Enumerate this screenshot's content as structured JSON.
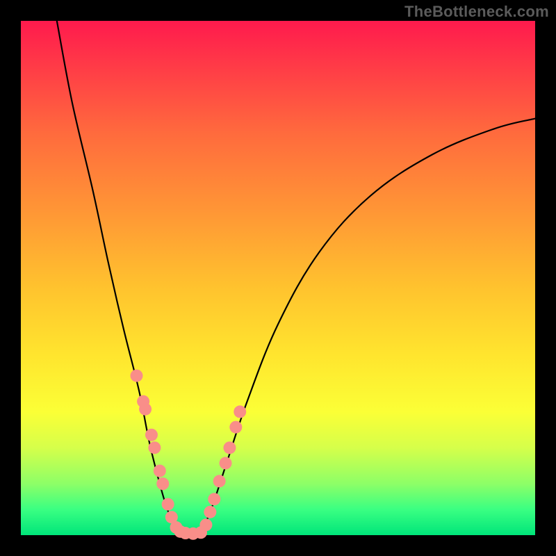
{
  "watermark": "TheBottleneck.com",
  "colors": {
    "frame": "#000000",
    "gradient_top": "#ff1a4d",
    "gradient_bottom": "#00e57a",
    "dot_fill": "#f98e89",
    "curve_stroke": "#000000"
  },
  "chart_data": {
    "type": "line",
    "title": "",
    "xlabel": "",
    "ylabel": "",
    "xlim": [
      0,
      100
    ],
    "ylim": [
      0,
      100
    ],
    "note": "Axes have no printed tick labels; values are normalized 0–100. Color gradient runs red (top, y≈100) → green (bottom, y≈0).",
    "series": [
      {
        "name": "left-branch",
        "x": [
          7,
          10,
          14,
          17,
          20,
          23,
          25,
          27,
          28.5,
          30,
          31
        ],
        "y": [
          100,
          84,
          67,
          53,
          40,
          28,
          18,
          10,
          5,
          1.5,
          0.5
        ]
      },
      {
        "name": "valley",
        "x": [
          31,
          33,
          35
        ],
        "y": [
          0.5,
          0.3,
          0.5
        ]
      },
      {
        "name": "right-branch",
        "x": [
          35,
          37,
          40,
          44,
          50,
          58,
          68,
          80,
          92,
          100
        ],
        "y": [
          0.5,
          5,
          14,
          26,
          41,
          55,
          66,
          74,
          79,
          81
        ]
      }
    ],
    "markers": {
      "name": "highlighted-points",
      "x": [
        22.5,
        23.8,
        24.2,
        25.4,
        26.0,
        27.0,
        27.6,
        28.6,
        29.3,
        30.2,
        31.0,
        32.0,
        33.5,
        35.0,
        36.0,
        36.8,
        37.6,
        38.6,
        39.8,
        40.6,
        41.8,
        42.6
      ],
      "y": [
        31.0,
        26.0,
        24.5,
        19.5,
        17.0,
        12.5,
        10.0,
        6.0,
        3.5,
        1.5,
        0.7,
        0.4,
        0.3,
        0.5,
        2.0,
        4.5,
        7.0,
        10.5,
        14.0,
        17.0,
        21.0,
        24.0
      ]
    }
  }
}
